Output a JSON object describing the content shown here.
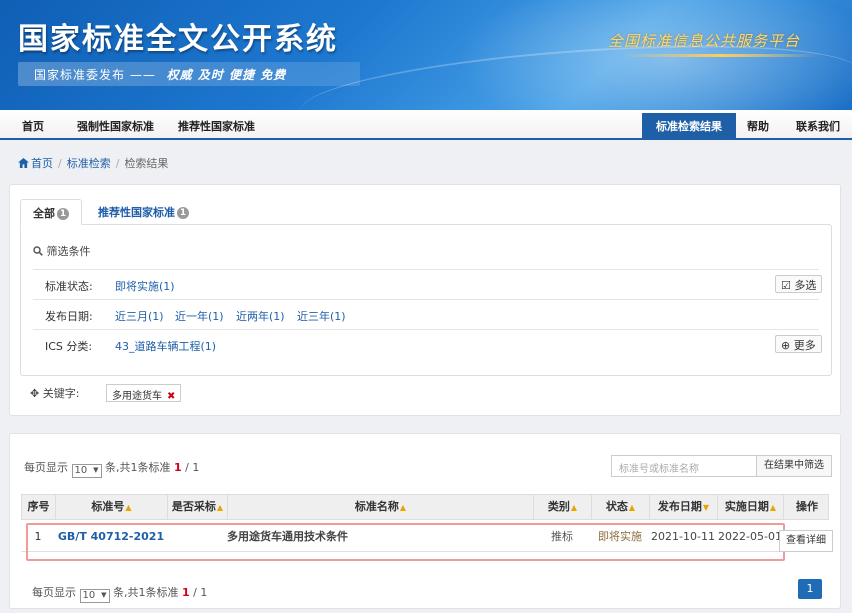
{
  "header": {
    "site_title": "国家标准全文公开系统",
    "slogan_left": "国家标准委发布 ——",
    "slogan_right": "权威 及时 便捷 免费",
    "right_slogan": "全国标准信息公共服务平台"
  },
  "nav": {
    "items": [
      "首页",
      "强制性国家标准",
      "推荐性国家标准"
    ],
    "right_items": [
      "标准检索结果",
      "帮助",
      "联系我们"
    ]
  },
  "breadcrumb": {
    "home": "首页",
    "search": "标准检索",
    "current": "检索结果"
  },
  "filter": {
    "tabs": [
      {
        "label": "全部",
        "count": "1"
      },
      {
        "label": "推荐性国家标准",
        "count": "1"
      }
    ],
    "title": "筛选条件",
    "status": {
      "label": "标准状态:",
      "options": [
        "即将实施(1)"
      ],
      "button": "多选"
    },
    "date": {
      "label": "发布日期:",
      "options": [
        "近三月(1)",
        "近一年(1)",
        "近两年(1)",
        "近三年(1)"
      ]
    },
    "ics": {
      "label": "ICS 分类:",
      "options": [
        "43_道路车辆工程(1)"
      ],
      "button": "更多"
    },
    "keyword_label": "关键字:",
    "keyword": "多用途货车"
  },
  "results": {
    "pager_top": {
      "prefix": "每页显示",
      "per_page": "10",
      "middle": "条,共",
      "total": "1",
      "suffix": "条标准",
      "page": "1",
      "pages": "/ 1"
    },
    "pager_bottom": {
      "prefix": "每页显示",
      "per_page": "10",
      "middle": "条,共",
      "total": "1",
      "suffix": "条标准",
      "page": "1",
      "pages": "/ 1"
    },
    "search_placeholder": "标准号或标准名称",
    "search_button": "在结果中筛选",
    "columns": [
      "序号",
      "标准号",
      "是否采标",
      "标准名称",
      "类别",
      "状态",
      "发布日期",
      "实施日期",
      "操作"
    ],
    "rows": [
      {
        "index": "1",
        "code": "GB/T 40712-2021",
        "adopted": "",
        "name": "多用途货车通用技术条件",
        "category": "推标",
        "status": "即将实施",
        "publish": "2021-10-11",
        "implement": "2022-05-01",
        "action": "查看详细"
      }
    ],
    "current_page": "1"
  },
  "colors": {
    "nav_active": "#1f5fa8",
    "link": "#1f5fa8",
    "red": "#d0021b",
    "sort_arrow": "#e8a400"
  }
}
